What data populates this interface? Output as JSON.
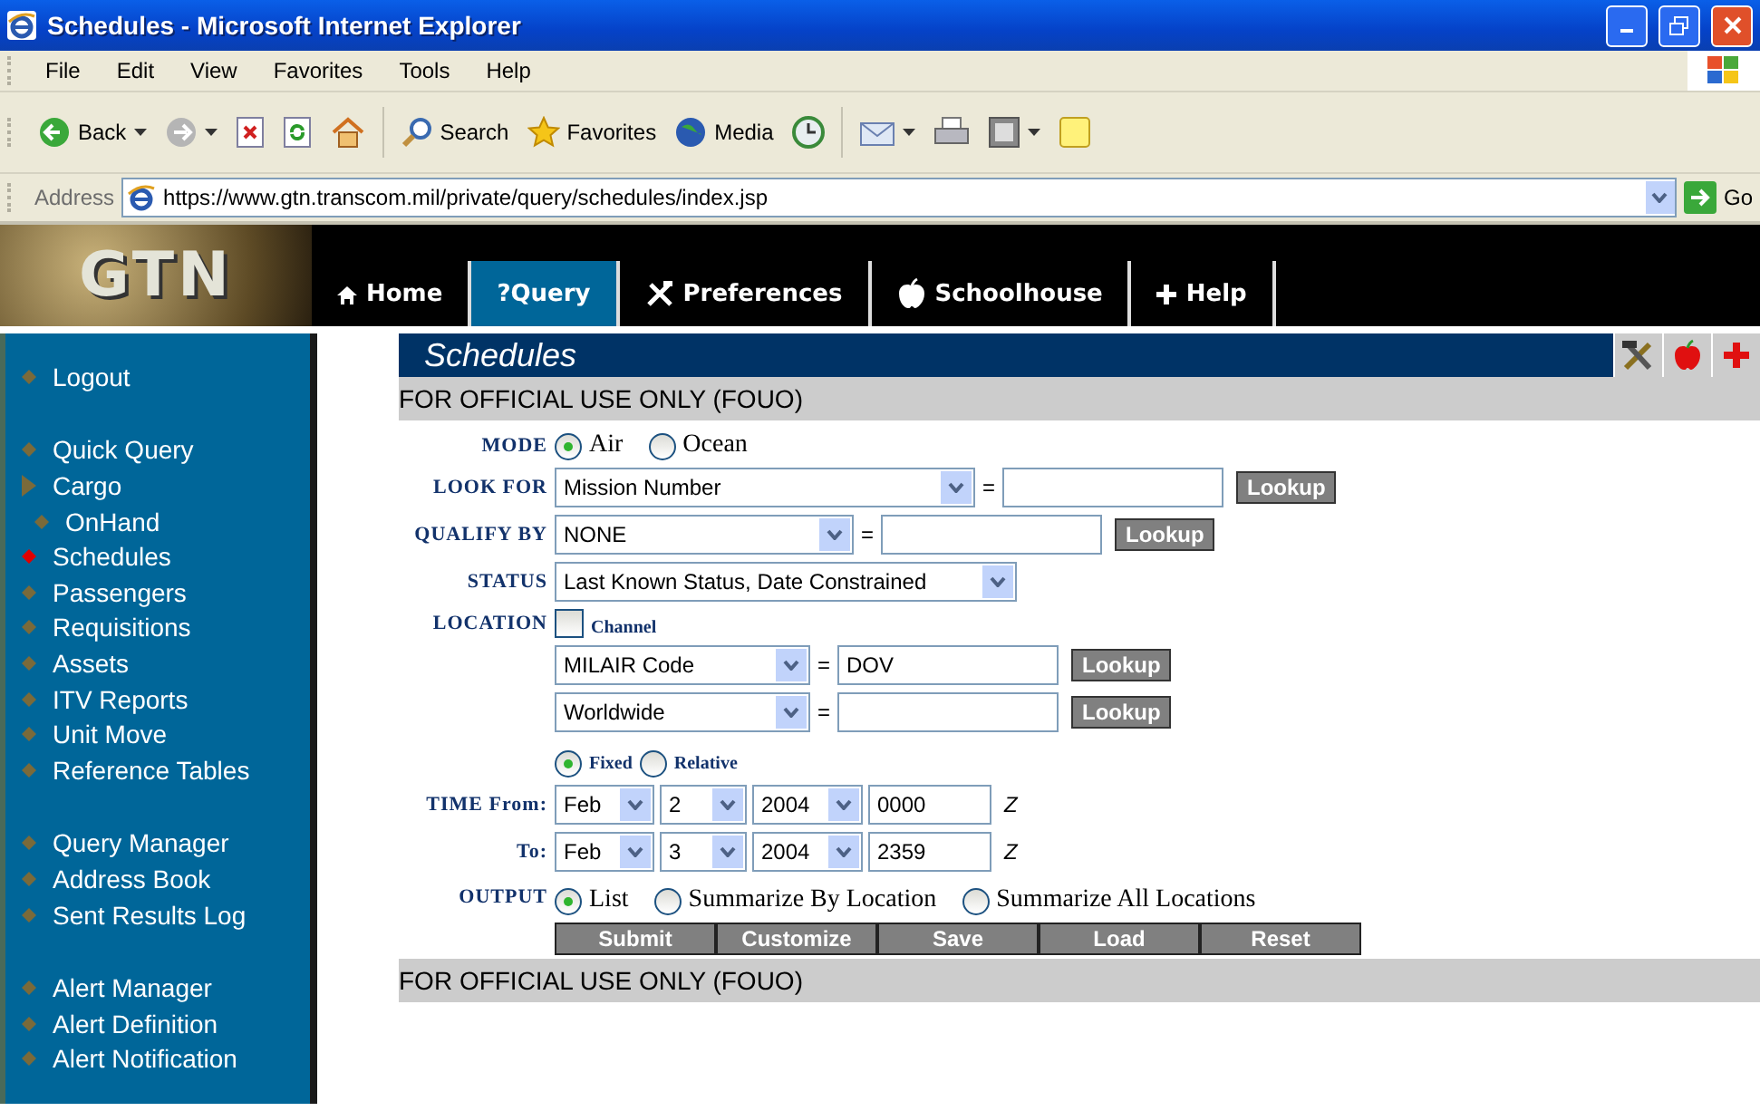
{
  "window": {
    "title": "Schedules - Microsoft Internet Explorer"
  },
  "menu": [
    "File",
    "Edit",
    "View",
    "Favorites",
    "Tools",
    "Help"
  ],
  "toolbar": [
    {
      "kind": "back",
      "label": "Back",
      "dropdown": true
    },
    {
      "kind": "forward",
      "dropdown": true
    },
    {
      "kind": "stop",
      "dropdown": false
    },
    {
      "kind": "refresh",
      "dropdown": false
    },
    {
      "kind": "home",
      "dropdown": false
    },
    {
      "kind": "search",
      "label": "Search",
      "dropdown": false
    },
    {
      "kind": "favorites",
      "label": "Favorites",
      "dropdown": false
    },
    {
      "kind": "media",
      "label": "Media",
      "dropdown": false
    },
    {
      "kind": "history",
      "dropdown": false
    },
    {
      "kind": "mail",
      "dropdown": true
    },
    {
      "kind": "print",
      "dropdown": false
    },
    {
      "kind": "edit",
      "dropdown": true
    },
    {
      "kind": "note",
      "dropdown": false
    }
  ],
  "address": {
    "label": "Address",
    "value": "https://www.gtn.transcom.mil/private/query/schedules/index.jsp",
    "go": "Go"
  },
  "site": {
    "logo": "GTN",
    "tabs": [
      {
        "label": "Home",
        "kind": "home",
        "selected": false
      },
      {
        "label": "?Query",
        "kind": "query",
        "selected": true
      },
      {
        "label": "Preferences",
        "kind": "tools",
        "selected": false
      },
      {
        "label": "Schoolhouse",
        "kind": "apple",
        "selected": false
      },
      {
        "label": "Help",
        "kind": "plus",
        "selected": false
      }
    ]
  },
  "sidebar": {
    "groups": [
      [
        {
          "label": "Logout",
          "selected": false,
          "expanded": false
        }
      ],
      [
        {
          "label": "Quick Query",
          "selected": false,
          "expanded": false
        },
        {
          "label": "Cargo",
          "selected": false,
          "expanded": true,
          "children": [
            {
              "label": "OnHand",
              "selected": false,
              "expanded": false
            }
          ]
        },
        {
          "label": "Schedules",
          "selected": true,
          "expanded": false
        },
        {
          "label": "Passengers",
          "selected": false,
          "expanded": false
        },
        {
          "label": "Requisitions",
          "selected": false,
          "expanded": false
        },
        {
          "label": "Assets",
          "selected": false,
          "expanded": false
        },
        {
          "label": "ITV Reports",
          "selected": false,
          "expanded": false
        },
        {
          "label": "Unit Move",
          "selected": false,
          "expanded": false
        },
        {
          "label": "Reference Tables",
          "selected": false,
          "expanded": false
        }
      ],
      [
        {
          "label": "Query Manager",
          "selected": false,
          "expanded": false
        },
        {
          "label": "Address Book",
          "selected": false,
          "expanded": false
        },
        {
          "label": "Sent Results Log",
          "selected": false,
          "expanded": false
        }
      ],
      [
        {
          "label": "Alert Manager",
          "selected": false,
          "expanded": false
        },
        {
          "label": "Alert Definition",
          "selected": false,
          "expanded": false
        },
        {
          "label": "Alert Notification",
          "selected": false,
          "expanded": false
        }
      ]
    ]
  },
  "page": {
    "title": "Schedules",
    "banner_top": "FOR OFFICIAL USE ONLY (FOUO)",
    "mode": {
      "label": "MODE",
      "options": [
        {
          "label": "Air",
          "selected": true
        },
        {
          "label": "Ocean",
          "selected": false
        }
      ]
    },
    "look_for": {
      "label": "LOOK FOR",
      "select": "Mission Number",
      "equals": "=",
      "lookup": "Lookup"
    },
    "qualify_by": {
      "label": "QUALIFY BY",
      "select": "NONE",
      "equals": "=",
      "lookup": "Lookup"
    },
    "status": {
      "label": "STATUS",
      "select": "Last Known Status, Date Constrained"
    },
    "location": {
      "label": "LOCATION",
      "channel": {
        "label": "Channel",
        "checked": false
      },
      "rows": [
        {
          "select": "MILAIR Code",
          "equals": "=",
          "value": "DOV",
          "lookup": "Lookup"
        },
        {
          "select": "Worldwide",
          "equals": "=",
          "lookup": "Lookup"
        }
      ]
    },
    "time": {
      "options": [
        {
          "label": "Fixed",
          "selected": true
        },
        {
          "label": "Relative",
          "selected": false
        }
      ],
      "rows": [
        {
          "label": "TIME From:",
          "month": "Feb",
          "day": "2",
          "year": "2004",
          "time": "0000",
          "zone": "Z"
        },
        {
          "label": "To:",
          "month": "Feb",
          "day": "3",
          "year": "2004",
          "time": "2359",
          "zone": "Z"
        }
      ]
    },
    "output": {
      "label": "OUTPUT",
      "options": [
        {
          "label": "List",
          "selected": true
        },
        {
          "label": "Summarize By Location",
          "selected": false
        },
        {
          "label": "Summarize All Locations",
          "selected": false
        }
      ]
    },
    "buttons": [
      "Submit",
      "Customize",
      "Save",
      "Load",
      "Reset"
    ],
    "banner_bottom": "FOR OFFICIAL USE ONLY (FOUO)"
  }
}
